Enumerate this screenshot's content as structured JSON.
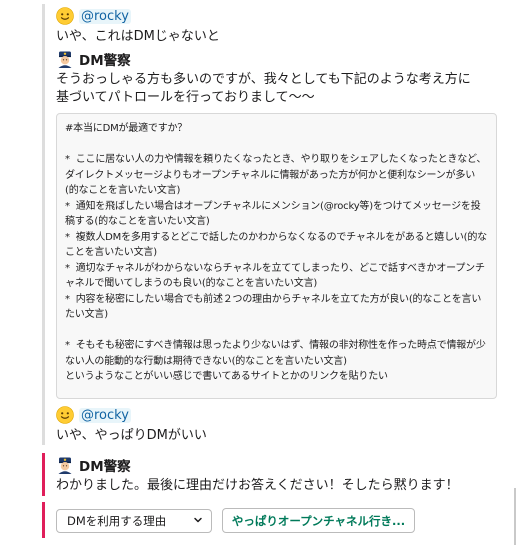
{
  "thread": {
    "msg1": {
      "mention": "@rocky",
      "text": "いや、これはDMじゃないと"
    },
    "msg2": {
      "author": "DM警察",
      "text_line1": "そうおっしゃる方も多いのですが、我々としても下記のような考え方に",
      "text_line2": "基づいてパトロールを行っておりまして〜〜",
      "code": "#本当にDMが最適ですか？\n\n*  ここに居ない人の力や情報を頼りたくなったとき、やり取りをシェアしたくなったときなど、ダイレクトメッセージよりもオープンチャネルに情報があった方が何かと便利なシーンが多い(的なことを言いたい文言)\n*  通知を飛ばしたい場合はオープンチャネルにメンション(@rocky等)をつけてメッセージを投稿する(的なことを言いたい文言)\n*  複数人DMを多用するとどこで話したのかわからなくなるのでチャネルをがあると嬉しい(的なことを言いたい文言)\n*  適切なチャネルがわからないならチャネルを立ててしまったり、どこで話すべきかオープンチャネルで聞いてしまうのも良い(的なことを言いたい文言)\n*  内容を秘密にしたい場合でも前述２つの理由からチャネルを立てた方が良い(的なことを言いたい文言)\n\n*  そもそも秘密にすべき情報は思ったより少ないはず、情報の非対称性を作った時点で情報が少ない人の能動的な行動は期待できない(的なことを言いたい文言)\nというようなことがいい感じで書いてあるサイトとかのリンクを貼りたい"
    },
    "msg3": {
      "mention": "@rocky",
      "text": "いや、やっぱりDMがいい"
    },
    "msg4": {
      "author": "DM警察",
      "text": "わかりました。最後に理由だけお答えください！そしたら黙ります！"
    }
  },
  "actions": {
    "select_placeholder": "DMを利用する理由",
    "button_label": "やっぱりオープンチャネル行き..."
  },
  "icons": {
    "face": "slightly-smiling-face-icon",
    "police": "police-officer-icon",
    "chevron": "chevron-down-icon"
  },
  "colors": {
    "mention": "#1264a3",
    "red_bar": "#e01e5a",
    "button_text": "#007a5a"
  }
}
